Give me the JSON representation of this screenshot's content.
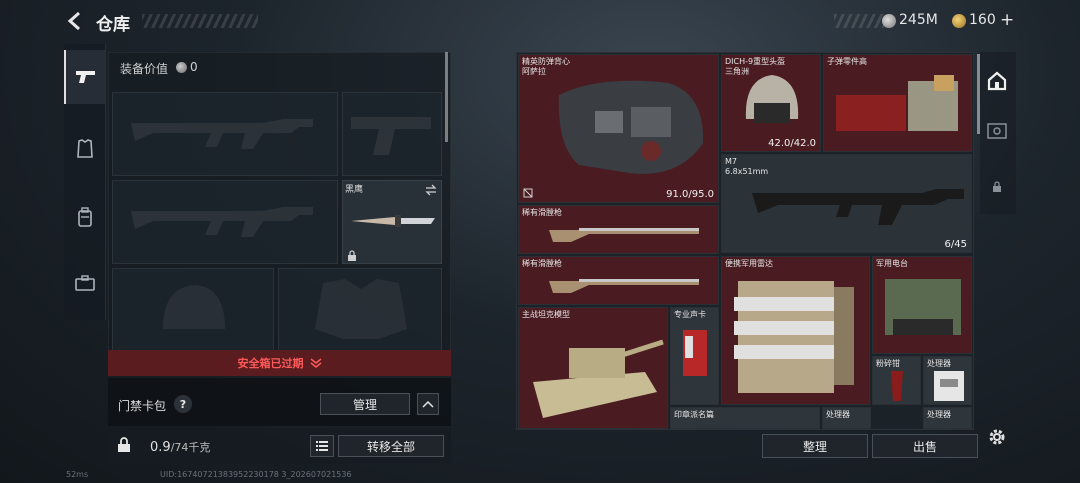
{
  "header": {
    "title": "仓库",
    "currency_silver": "245M",
    "currency_gold": "160",
    "gold_plus": "+"
  },
  "equipment": {
    "value_label": "装备价值",
    "value": "0",
    "melee_name": "黑鹰"
  },
  "safebox": {
    "label": "安全箱已过期"
  },
  "keycard": {
    "label": "门禁卡包",
    "help": "?",
    "manage_label": "管理"
  },
  "bottom": {
    "weight": "0.9",
    "capacity": "/74千克",
    "transfer_all_label": "转移全部"
  },
  "footer": {
    "signal": "52ms",
    "uid": "UID:16740721383952230178 3_202607021536"
  },
  "inventory": {
    "items": [
      {
        "id": "vest",
        "name": "精英防弹背心\n阿萨拉",
        "qty": "91.0/95.0"
      },
      {
        "id": "helmet",
        "name": "DICH-9重型头盔\n三角洲",
        "qty": "42.0/42.0"
      },
      {
        "id": "ammo_parts",
        "name": "子弹零件高",
        "qty": ""
      },
      {
        "id": "m7",
        "name": "M7\n6.8x51mm",
        "qty": "6/45"
      },
      {
        "id": "musket_1",
        "name": "稀有滑膛枪",
        "qty": ""
      },
      {
        "id": "musket_2",
        "name": "稀有滑膛枪",
        "qty": ""
      },
      {
        "id": "radar",
        "name": "便携军用雷达",
        "qty": ""
      },
      {
        "id": "radio",
        "name": "军用电台",
        "qty": ""
      },
      {
        "id": "tank",
        "name": "主战坦克模型",
        "qty": ""
      },
      {
        "id": "soundcard",
        "name": "专业声卡",
        "qty": ""
      },
      {
        "id": "crusher",
        "name": "粉碎钳",
        "qty": ""
      },
      {
        "id": "processor_1",
        "name": "处理器",
        "qty": ""
      },
      {
        "id": "seal",
        "name": "印章派名篇",
        "qty": ""
      },
      {
        "id": "processor_2",
        "name": "处理器",
        "qty": ""
      },
      {
        "id": "processor_3",
        "name": "处理器",
        "qty": ""
      }
    ],
    "sort_label": "整理",
    "sell_label": "出售"
  },
  "colors": {
    "rare_cell": "#4a1c21",
    "safebox_warning": "#ff5a5a",
    "panel": "#1b2228"
  },
  "icons": [
    "back-icon",
    "pistol-icon",
    "armor-icon",
    "backpack-icon",
    "briefcase-icon",
    "lock-icon",
    "list-icon",
    "settings-icon",
    "home-icon"
  ]
}
